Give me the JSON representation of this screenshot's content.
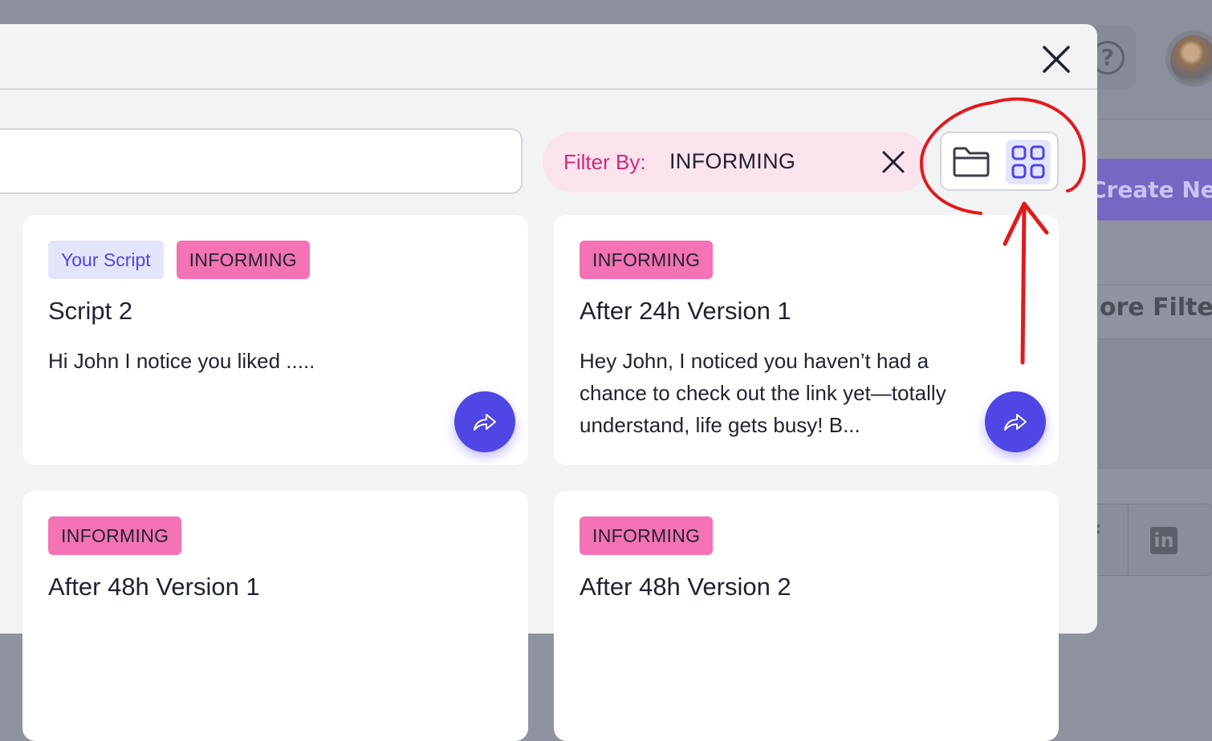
{
  "background": {
    "help_glyph": "?",
    "create_button_label": "Create New",
    "filters_label": "More Filters",
    "social_icons": [
      "facebook-icon",
      "linkedin-icon"
    ]
  },
  "modal": {
    "search": {
      "placeholder": "",
      "value": ""
    },
    "filter": {
      "label": "Filter By:",
      "value": "INFORMING"
    },
    "view_toggle": {
      "options": [
        "folder-view",
        "grid-view"
      ],
      "active": "grid-view"
    },
    "cards": [
      {
        "tags": [
          "Your Script",
          "INFORMING"
        ],
        "title": "Script 2",
        "body": "Hi John I notice you liked ....."
      },
      {
        "tags": [
          "INFORMING"
        ],
        "title": "After 24h Version 1",
        "body": "Hey John, I noticed you haven’t had a chance to check out the link yet—totally understand, life gets busy! B..."
      },
      {
        "tags": [
          "INFORMING"
        ],
        "title": "After 48h Version 1",
        "body": ""
      },
      {
        "tags": [
          "INFORMING"
        ],
        "title": "After 48h Version 2",
        "body": ""
      }
    ]
  },
  "colors": {
    "accent": "#4f46e5",
    "tag_pink": "#f472b6",
    "filter_pink_text": "#d0287a",
    "annotation_red": "#e01b1b"
  }
}
